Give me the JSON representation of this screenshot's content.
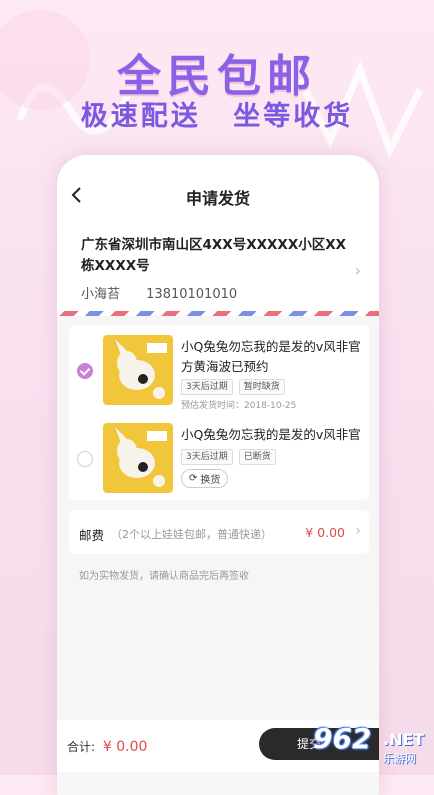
{
  "promo": {
    "headline": "全民包邮",
    "sub_left": "极速配送",
    "sub_right": "坐等收货"
  },
  "nav": {
    "title": "申请发货",
    "back_icon": "back-arrow-icon"
  },
  "address": {
    "full": "广东省深圳市南山区4XX号XXXXX小区XX栋XXXX号",
    "name": "小海苔",
    "phone": "13810101010"
  },
  "items": [
    {
      "name": "小Q兔兔勿忘我的是发的v风非官方黄海波已预约",
      "tags": [
        "3天后过期",
        "暂时缺货"
      ],
      "date": "预估发货时间：2018-10-25",
      "checked": true
    },
    {
      "name": "小Q兔兔勿忘我的是发的v风非官",
      "tags": [
        "3天后过期",
        "已断货"
      ],
      "swap_label": "换货",
      "checked": false
    }
  ],
  "shipping": {
    "label": "邮费",
    "hint": "（2个以上娃娃包邮，普通快递）",
    "price": "¥ 0.00"
  },
  "note": "如为实物发货，请确认商品完后再签收",
  "footer": {
    "total_label": "合计:",
    "total_value": "¥ 0.00",
    "submit_label": "提交"
  },
  "watermark": {
    "number": "962",
    "domain": ".NET",
    "site": "乐游网"
  },
  "colors": {
    "accent": "#8b61e6",
    "price": "#e04a4a",
    "checked": "#c980d9"
  }
}
